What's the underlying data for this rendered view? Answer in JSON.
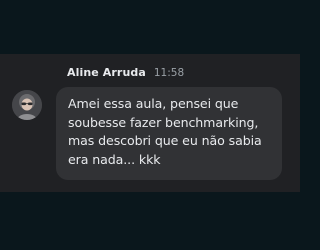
{
  "message": {
    "sender_name": "Aline Arruda",
    "timestamp": "11:58",
    "text": "Amei essa aula, pensei que soubesse fazer benchmarking, mas descobri que eu não sabia era nada... kkk"
  },
  "icons": {
    "avatar": "user-avatar-photo"
  },
  "colors": {
    "page_background": "#0a171c",
    "message_area_background": "#202124",
    "bubble_background": "#313235",
    "primary_text": "#e8eaed",
    "secondary_text": "#9aa0a6"
  }
}
